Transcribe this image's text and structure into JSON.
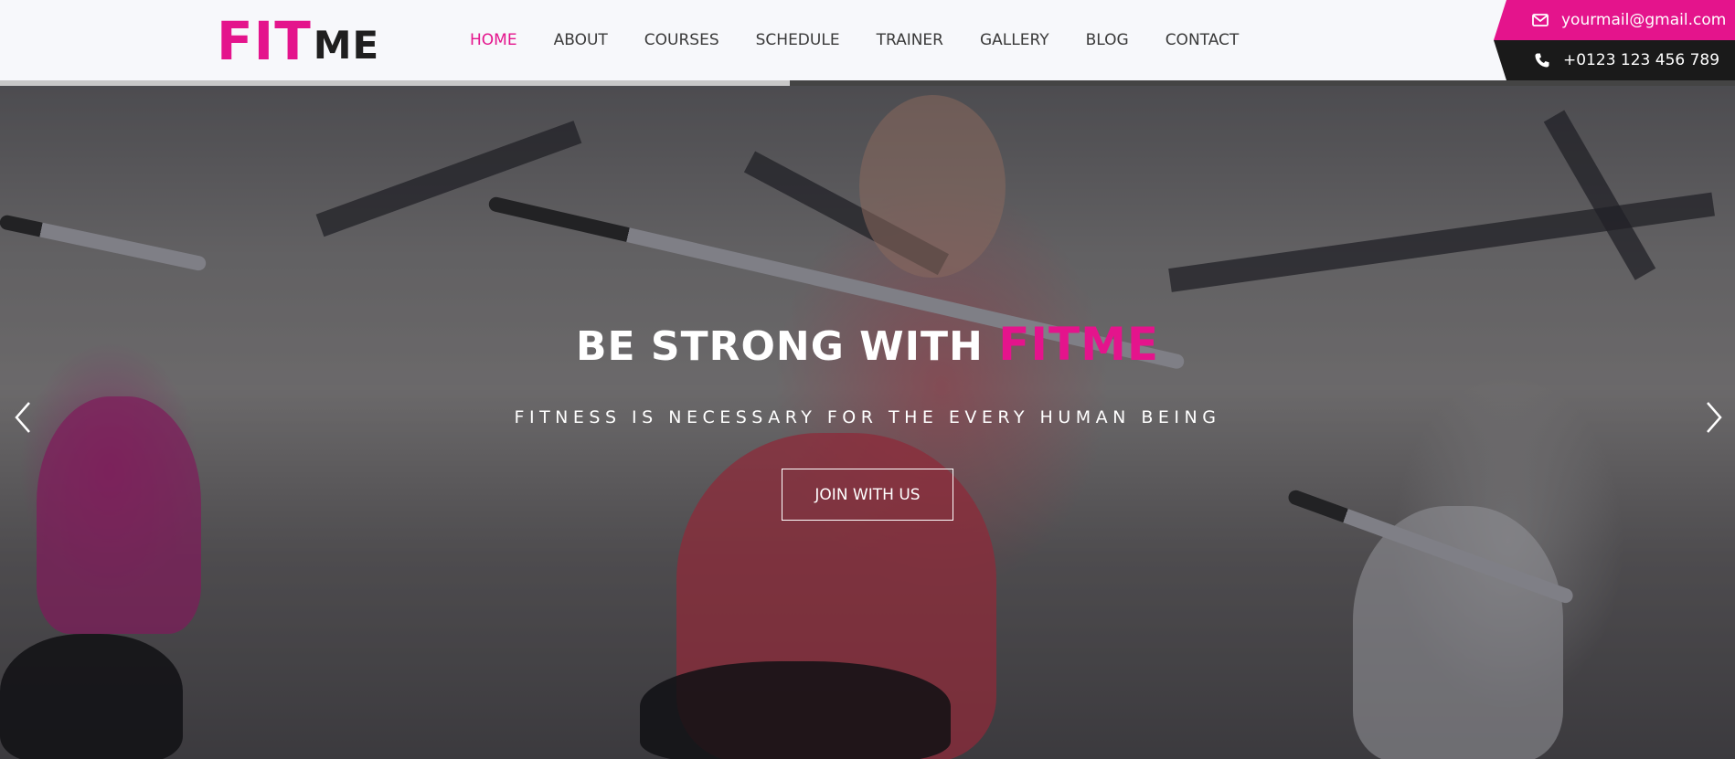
{
  "logo": {
    "part1": "FIT",
    "part2": "ME"
  },
  "nav": {
    "items": [
      {
        "label": "HOME",
        "active": true
      },
      {
        "label": "ABOUT",
        "active": false
      },
      {
        "label": "COURSES",
        "active": false
      },
      {
        "label": "SCHEDULE",
        "active": false
      },
      {
        "label": "TRAINER",
        "active": false
      },
      {
        "label": "GALLERY",
        "active": false
      },
      {
        "label": "BLOG",
        "active": false
      },
      {
        "label": "CONTACT",
        "active": false
      }
    ]
  },
  "contact": {
    "email": "yourmail@gmail.com",
    "email_icon": "envelope-icon",
    "phone": "+0123 123 456 789",
    "phone_icon": "phone-icon"
  },
  "hero": {
    "title_prefix": "BE STRONG WITH",
    "title_brand": "FITME",
    "subtitle": "FITNESS IS NECESSARY FOR THE EVERY HUMAN BEING",
    "button_label": "JOIN WITH US",
    "prev_icon": "chevron-left-icon",
    "next_icon": "chevron-right-icon",
    "slide_progress": 0.455
  },
  "colors": {
    "accent": "#e4148c",
    "dark": "#1a1a1a",
    "header_bg": "#f7f8fb"
  }
}
